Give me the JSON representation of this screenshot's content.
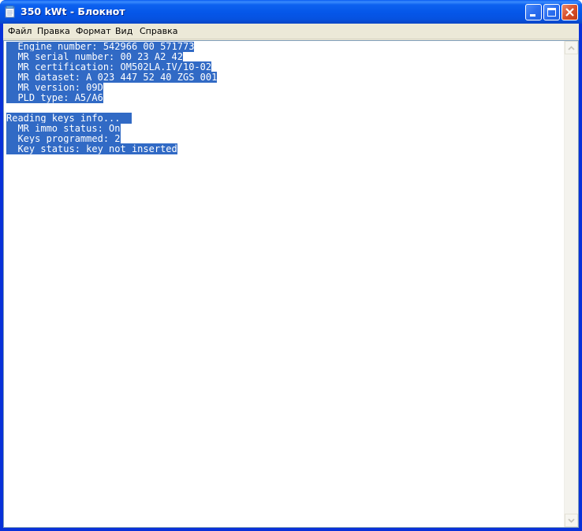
{
  "window": {
    "title": "350 kWt - Блокнот"
  },
  "menu": {
    "file": "Файл",
    "edit": "Правка",
    "format": "Формат",
    "view": "Вид",
    "help": "Справка"
  },
  "document": {
    "lines": [
      "  Engine number: 542966 00 571773",
      "  MR serial number: 00 23 A2 42",
      "  MR certification: OM502LA.IV/10-02",
      "  MR dataset: A 023 447 52 40 ZGS 001",
      "  MR version: 09D",
      "  PLD type: A5/A6",
      "",
      "Reading keys info...  ",
      "  MR immo status: On",
      "  Keys programmed: 2",
      "  Key status: key not inserted"
    ]
  },
  "colors": {
    "selection": "#316ac5",
    "titlebar": "#0556e8",
    "menu_background": "#ece9d8"
  }
}
